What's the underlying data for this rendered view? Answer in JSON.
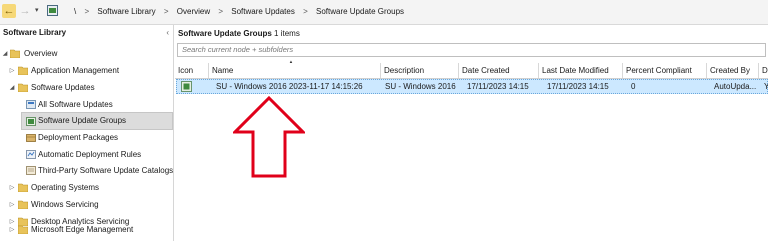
{
  "breadcrumb": {
    "root_sep": "\\",
    "items": [
      "Software Library",
      "Overview",
      "Software Updates",
      "Software Update Groups"
    ],
    "separator": ">"
  },
  "left_pane": {
    "title": "Software Library",
    "collapse_glyph": "‹",
    "tree": [
      {
        "label": "Overview",
        "expanded": true
      },
      {
        "label": "Application Management",
        "expanded": false
      },
      {
        "label": "Software Updates",
        "expanded": true
      },
      {
        "label": "All Software Updates"
      },
      {
        "label": "Software Update Groups",
        "selected": true
      },
      {
        "label": "Deployment Packages"
      },
      {
        "label": "Automatic Deployment Rules"
      },
      {
        "label": "Third-Party Software Update Catalogs"
      },
      {
        "label": "Operating Systems",
        "expanded": false
      },
      {
        "label": "Windows Servicing",
        "expanded": false
      },
      {
        "label": "Desktop Analytics Servicing",
        "expanded": false
      },
      {
        "label": "Microsoft Edge Management",
        "expanded": false
      }
    ]
  },
  "list": {
    "title": "Software Update Groups",
    "count": "1 items",
    "search_placeholder": "Search current node + subfolders",
    "columns": [
      "Icon",
      "Name",
      "Description",
      "Date Created",
      "Last Date Modified",
      "Percent Compliant",
      "Created By",
      "D"
    ],
    "rows": [
      {
        "name": "SU - Windows 2016 2023-11-17 14:15:26",
        "description": "SU - Windows 2016",
        "date_created": "17/11/2023 14:15",
        "last_modified": "17/11/2023 14:15",
        "percent_compliant": "0",
        "created_by": "AutoUpda...",
        "d": "Y"
      }
    ]
  },
  "colors": {
    "selection_fill": "#cce8ff",
    "folder": "#e8c35a",
    "annotation_arrow": "#e0001a"
  }
}
